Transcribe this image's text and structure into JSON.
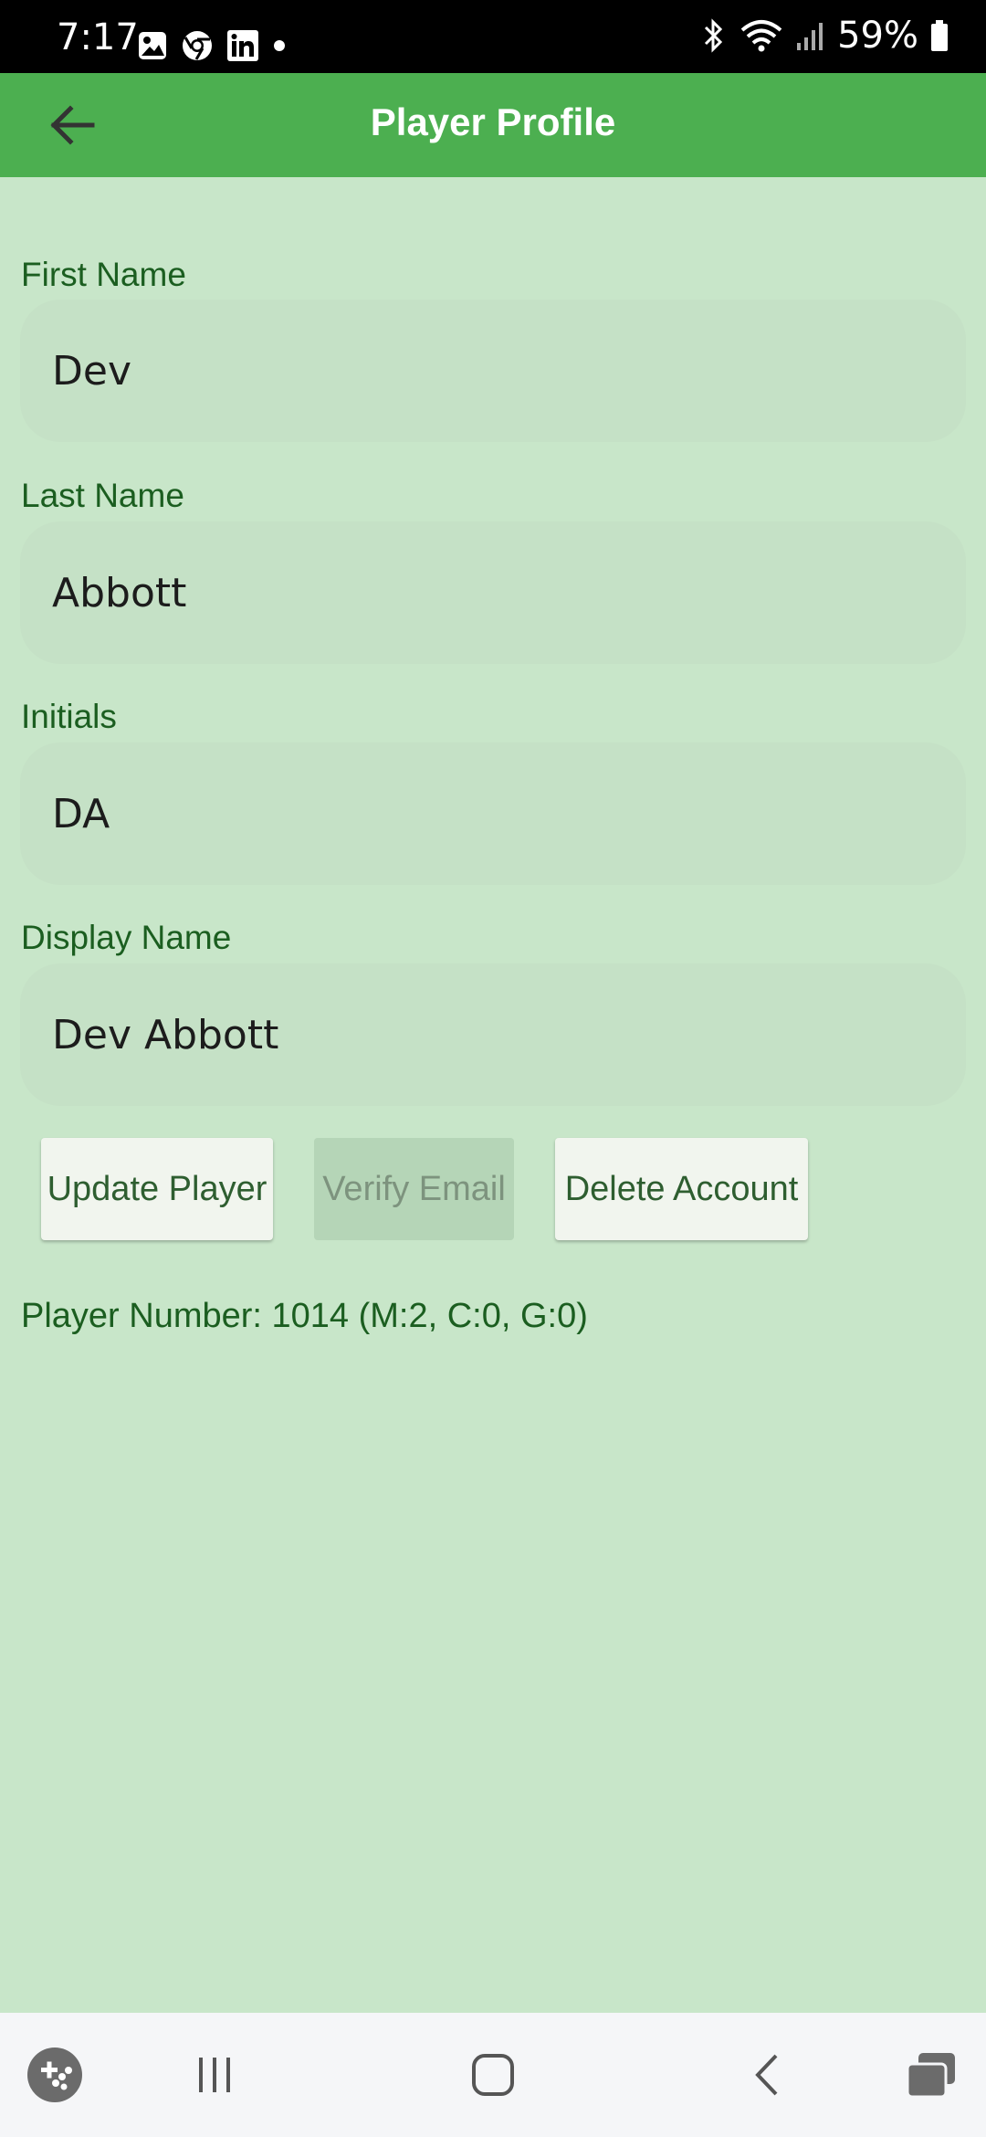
{
  "status_bar": {
    "time": "7:17",
    "battery": "59%",
    "left_icons": [
      "gallery-icon",
      "chrome-icon",
      "linkedin-icon",
      "dot-icon"
    ],
    "right_icons": [
      "bluetooth-icon",
      "wifi-icon",
      "signal-icon",
      "battery-icon"
    ]
  },
  "app_bar": {
    "title": "Player Profile",
    "back_icon": "back-arrow-icon",
    "color": "#4caf50"
  },
  "form": {
    "first_name": {
      "label": "First Name",
      "value": "Dev"
    },
    "last_name": {
      "label": "Last Name",
      "value": "Abbott"
    },
    "initials": {
      "label": "Initials",
      "value": "DA"
    },
    "display_name": {
      "label": "Display Name",
      "value": "Dev Abbott"
    }
  },
  "buttons": {
    "update": "Update Player",
    "verify": "Verify Email",
    "delete": "Delete Account"
  },
  "player_number": "Player Number: 1014 (M:2, C:0, G:0)",
  "nav_bar": {
    "items": [
      "game-launcher-icon",
      "recent-apps-icon",
      "home-icon",
      "back-icon",
      "multi-window-icon"
    ]
  },
  "colors": {
    "background": "#c8e6c9",
    "accent": "#4caf50",
    "label": "#1b5e20"
  }
}
